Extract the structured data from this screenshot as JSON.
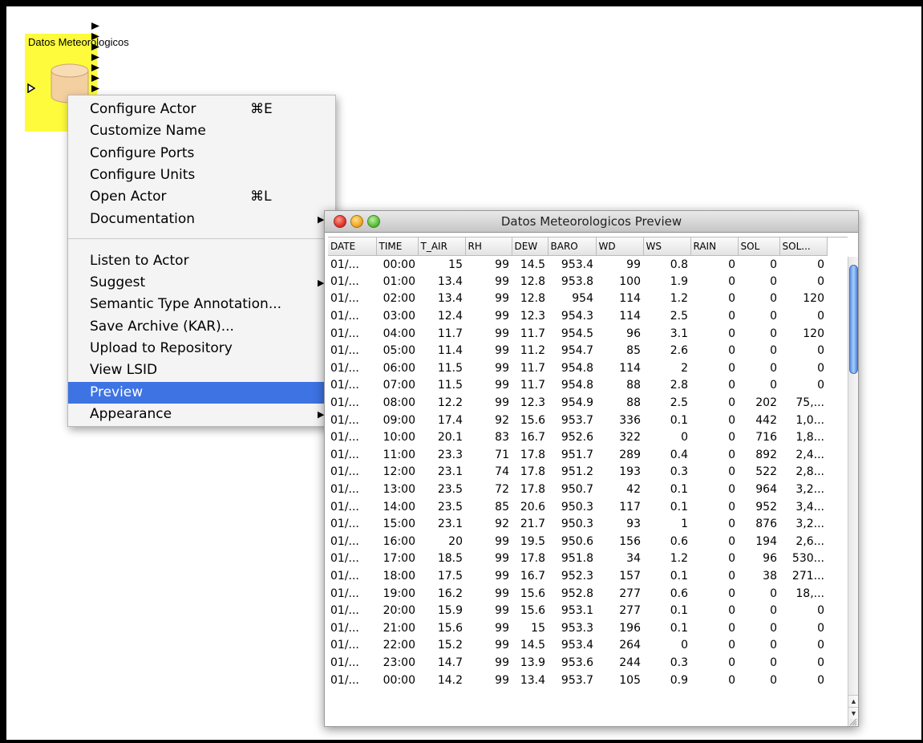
{
  "actor": {
    "label": "Datos Meteorologicos"
  },
  "context_menu": {
    "groups": [
      [
        {
          "label": "Configure Actor",
          "shortcut": "⌘E"
        },
        {
          "label": "Customize Name"
        },
        {
          "label": "Configure Ports"
        },
        {
          "label": "Configure Units"
        },
        {
          "label": "Open Actor",
          "shortcut": "⌘L"
        },
        {
          "label": "Documentation",
          "submenu": true
        }
      ],
      [
        {
          "label": "Listen to Actor"
        },
        {
          "label": "Suggest",
          "submenu": true
        },
        {
          "label": "Semantic Type Annotation..."
        },
        {
          "label": "Save Archive (KAR)..."
        },
        {
          "label": "Upload to Repository"
        },
        {
          "label": "View LSID"
        },
        {
          "label": "Preview",
          "highlighted": true
        },
        {
          "label": "Appearance",
          "submenu": true
        }
      ]
    ]
  },
  "preview_window": {
    "title": "Datos Meteorologicos Preview",
    "columns": [
      "DATE",
      "TIME",
      "T_AIR",
      "RH",
      "DEW",
      "BARO",
      "WD",
      "WS",
      "RAIN",
      "SOL",
      "SOL..."
    ],
    "rows": [
      [
        "01/...",
        "00:00",
        "15",
        "99",
        "14.5",
        "953.4",
        "99",
        "0.8",
        "0",
        "0",
        "0"
      ],
      [
        "01/...",
        "01:00",
        "13.4",
        "99",
        "12.8",
        "953.8",
        "100",
        "1.9",
        "0",
        "0",
        "0"
      ],
      [
        "01/...",
        "02:00",
        "13.4",
        "99",
        "12.8",
        "954",
        "114",
        "1.2",
        "0",
        "0",
        "120"
      ],
      [
        "01/...",
        "03:00",
        "12.4",
        "99",
        "12.3",
        "954.3",
        "114",
        "2.5",
        "0",
        "0",
        "0"
      ],
      [
        "01/...",
        "04:00",
        "11.7",
        "99",
        "11.7",
        "954.5",
        "96",
        "3.1",
        "0",
        "0",
        "120"
      ],
      [
        "01/...",
        "05:00",
        "11.4",
        "99",
        "11.2",
        "954.7",
        "85",
        "2.6",
        "0",
        "0",
        "0"
      ],
      [
        "01/...",
        "06:00",
        "11.5",
        "99",
        "11.7",
        "954.8",
        "114",
        "2",
        "0",
        "0",
        "0"
      ],
      [
        "01/...",
        "07:00",
        "11.5",
        "99",
        "11.7",
        "954.8",
        "88",
        "2.8",
        "0",
        "0",
        "0"
      ],
      [
        "01/...",
        "08:00",
        "12.2",
        "99",
        "12.3",
        "954.9",
        "88",
        "2.5",
        "0",
        "202",
        "75,..."
      ],
      [
        "01/...",
        "09:00",
        "17.4",
        "92",
        "15.6",
        "953.7",
        "336",
        "0.1",
        "0",
        "442",
        "1,0..."
      ],
      [
        "01/...",
        "10:00",
        "20.1",
        "83",
        "16.7",
        "952.6",
        "322",
        "0",
        "0",
        "716",
        "1,8..."
      ],
      [
        "01/...",
        "11:00",
        "23.3",
        "71",
        "17.8",
        "951.7",
        "289",
        "0.4",
        "0",
        "892",
        "2,4..."
      ],
      [
        "01/...",
        "12:00",
        "23.1",
        "74",
        "17.8",
        "951.2",
        "193",
        "0.3",
        "0",
        "522",
        "2,8..."
      ],
      [
        "01/...",
        "13:00",
        "23.5",
        "72",
        "17.8",
        "950.7",
        "42",
        "0.1",
        "0",
        "964",
        "3,2..."
      ],
      [
        "01/...",
        "14:00",
        "23.5",
        "85",
        "20.6",
        "950.3",
        "117",
        "0.1",
        "0",
        "952",
        "3,4..."
      ],
      [
        "01/...",
        "15:00",
        "23.1",
        "92",
        "21.7",
        "950.3",
        "93",
        "1",
        "0",
        "876",
        "3,2..."
      ],
      [
        "01/...",
        "16:00",
        "20",
        "99",
        "19.5",
        "950.6",
        "156",
        "0.6",
        "0",
        "194",
        "2,6..."
      ],
      [
        "01/...",
        "17:00",
        "18.5",
        "99",
        "17.8",
        "951.8",
        "34",
        "1.2",
        "0",
        "96",
        "530..."
      ],
      [
        "01/...",
        "18:00",
        "17.5",
        "99",
        "16.7",
        "952.3",
        "157",
        "0.1",
        "0",
        "38",
        "271..."
      ],
      [
        "01/...",
        "19:00",
        "16.2",
        "99",
        "15.6",
        "952.8",
        "277",
        "0.6",
        "0",
        "0",
        "18,..."
      ],
      [
        "01/...",
        "20:00",
        "15.9",
        "99",
        "15.6",
        "953.1",
        "277",
        "0.1",
        "0",
        "0",
        "0"
      ],
      [
        "01/...",
        "21:00",
        "15.6",
        "99",
        "15",
        "953.3",
        "196",
        "0.1",
        "0",
        "0",
        "0"
      ],
      [
        "01/...",
        "22:00",
        "15.2",
        "99",
        "14.5",
        "953.4",
        "264",
        "0",
        "0",
        "0",
        "0"
      ],
      [
        "01/...",
        "23:00",
        "14.7",
        "99",
        "13.9",
        "953.6",
        "244",
        "0.3",
        "0",
        "0",
        "0"
      ],
      [
        "01/...",
        "00:00",
        "14.2",
        "99",
        "13.4",
        "953.7",
        "105",
        "0.9",
        "0",
        "0",
        "0"
      ]
    ]
  },
  "colors": {
    "actor_background": "#fdfb3b",
    "menu_highlight": "#3d73e3",
    "database_icon": "#f4cfa0"
  },
  "icons": [
    "database-icon",
    "input-port-icon",
    "output-port-icon",
    "close-button",
    "minimize-button",
    "zoom-button",
    "resize-grip-icon"
  ]
}
